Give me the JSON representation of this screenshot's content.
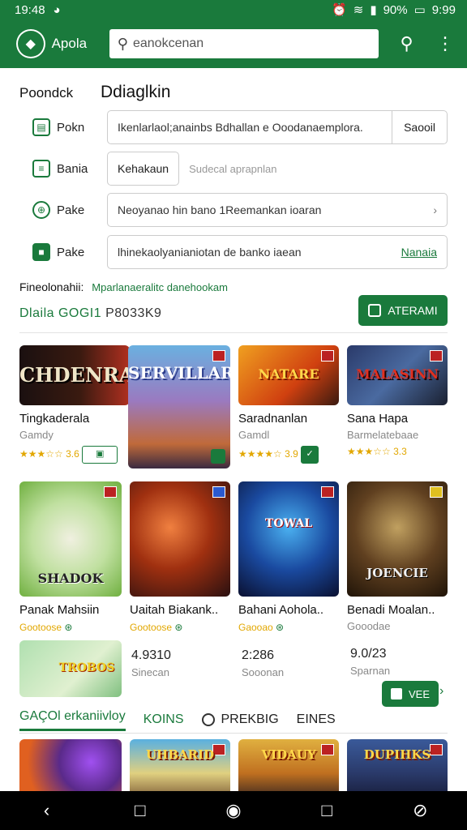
{
  "status": {
    "time": "19:48",
    "battery": "90%",
    "clock": "9:99"
  },
  "appbar": {
    "app_name": "Apola",
    "search_placeholder": "eanokcenan"
  },
  "section": {
    "label": "Poondck",
    "title": "Ddiaglkin"
  },
  "form": [
    {
      "label": "Pokn",
      "value": "Ikenlarlaol;anainbs Bdhallan e Ooodanaemplora.",
      "action": "Saooil"
    },
    {
      "label": "Bania",
      "pill": "Kehakaun",
      "hint": "Sudecal aprapnlan"
    },
    {
      "label": "Pake",
      "value": "Neoyanao hin bano 1Reemankan ioaran",
      "chevron": "›"
    },
    {
      "label": "Pake",
      "value": "lhinekaolyanianiotan de banko iaean",
      "link": "Nanaia"
    }
  ],
  "info": {
    "heading": "Fineolonahii:",
    "heading_note": "Mparlanaeralitc danehookam",
    "code_prefix": "Dlaila GOGI1",
    "code_value": "P8033K9",
    "cta": "ATERAMI"
  },
  "games_row1": [
    {
      "art_title": "CHDENRA",
      "name": "Tingkaderala",
      "sub": "Gamdy",
      "rating": "★★★☆☆ 3.6"
    },
    {
      "art_title": "SERVILLAR",
      "name": "",
      "sub": "",
      "rating": ""
    },
    {
      "art_title": "NATARE",
      "name": "Saradnanlan",
      "sub": "Gamdl",
      "rating": "★★★★☆ 3.9"
    },
    {
      "art_title": "MALASINN",
      "name": "Sana Hapa",
      "sub": "Barmelatebaae",
      "rating": "★★★☆☆ 3.3"
    }
  ],
  "games_row2": [
    {
      "art_title": "SHADOK",
      "name": "Panak Mahsiin",
      "sub": "Gootoose"
    },
    {
      "art_title": "",
      "name": "Uaitah Biakank..",
      "sub": "Gootoose"
    },
    {
      "art_title": "TOWAL",
      "name": "Bahani Aohola..",
      "sub": "Gaooao"
    },
    {
      "art_title": "JOENCIE",
      "name": "Benadi Moalan..",
      "sub": "Gooodae"
    }
  ],
  "games_row3": [
    {
      "art_title": "TROBOS",
      "num": "",
      "sub": ""
    },
    {
      "num": "4.9310",
      "sub": "Sinecan"
    },
    {
      "num": "2:286",
      "sub": "Sooonan"
    },
    {
      "num": "9.0/23",
      "sub": "Sparnan"
    }
  ],
  "vee_label": "VEE",
  "tabs": {
    "t1": "GAÇOl erkaniivloy",
    "t2": "KOINS",
    "t3": "PREKBIG",
    "t4": "EINES"
  },
  "bottom_row": [
    "",
    "UHBARID",
    "VIDAUY",
    "DUPIHKS"
  ],
  "colors": {
    "brand": "#1a7a3c",
    "rating": "#e2a700"
  }
}
